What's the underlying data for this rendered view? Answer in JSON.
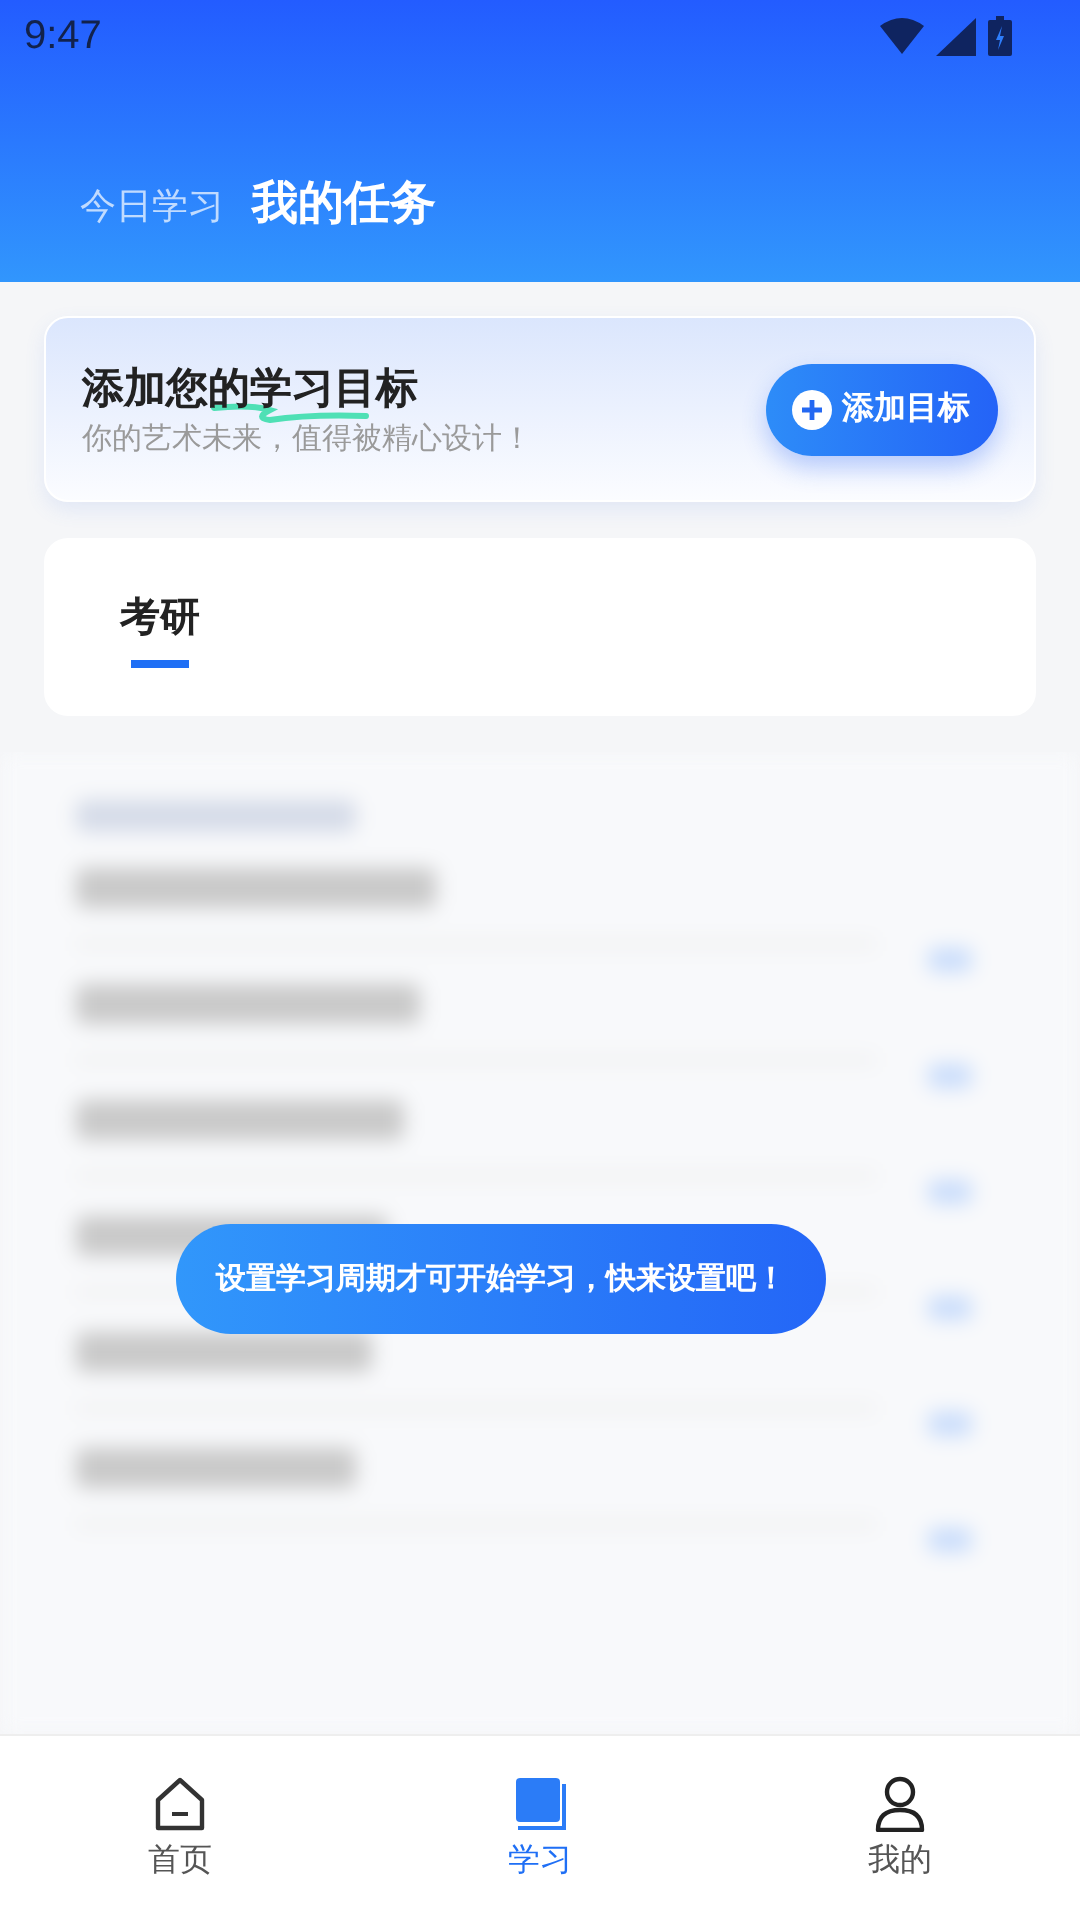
{
  "status_bar": {
    "time": "9:47"
  },
  "header": {
    "tabs": [
      {
        "label": "今日学习",
        "selected": false
      },
      {
        "label": "我的任务",
        "selected": true
      }
    ]
  },
  "goal_card": {
    "title": "添加您的学习目标",
    "subtitle": "你的艺术未来，值得被精心设计！",
    "button": "添加目标"
  },
  "category_tabs": [
    {
      "label": "考研",
      "selected": true
    }
  ],
  "toast": "设置学习周期才可开始学习，快来设置吧！",
  "bottom_nav": [
    {
      "label": "首页",
      "kind": "home",
      "selected": false
    },
    {
      "label": "学习",
      "kind": "study",
      "selected": true
    },
    {
      "label": "我的",
      "kind": "profile",
      "selected": false
    }
  ]
}
